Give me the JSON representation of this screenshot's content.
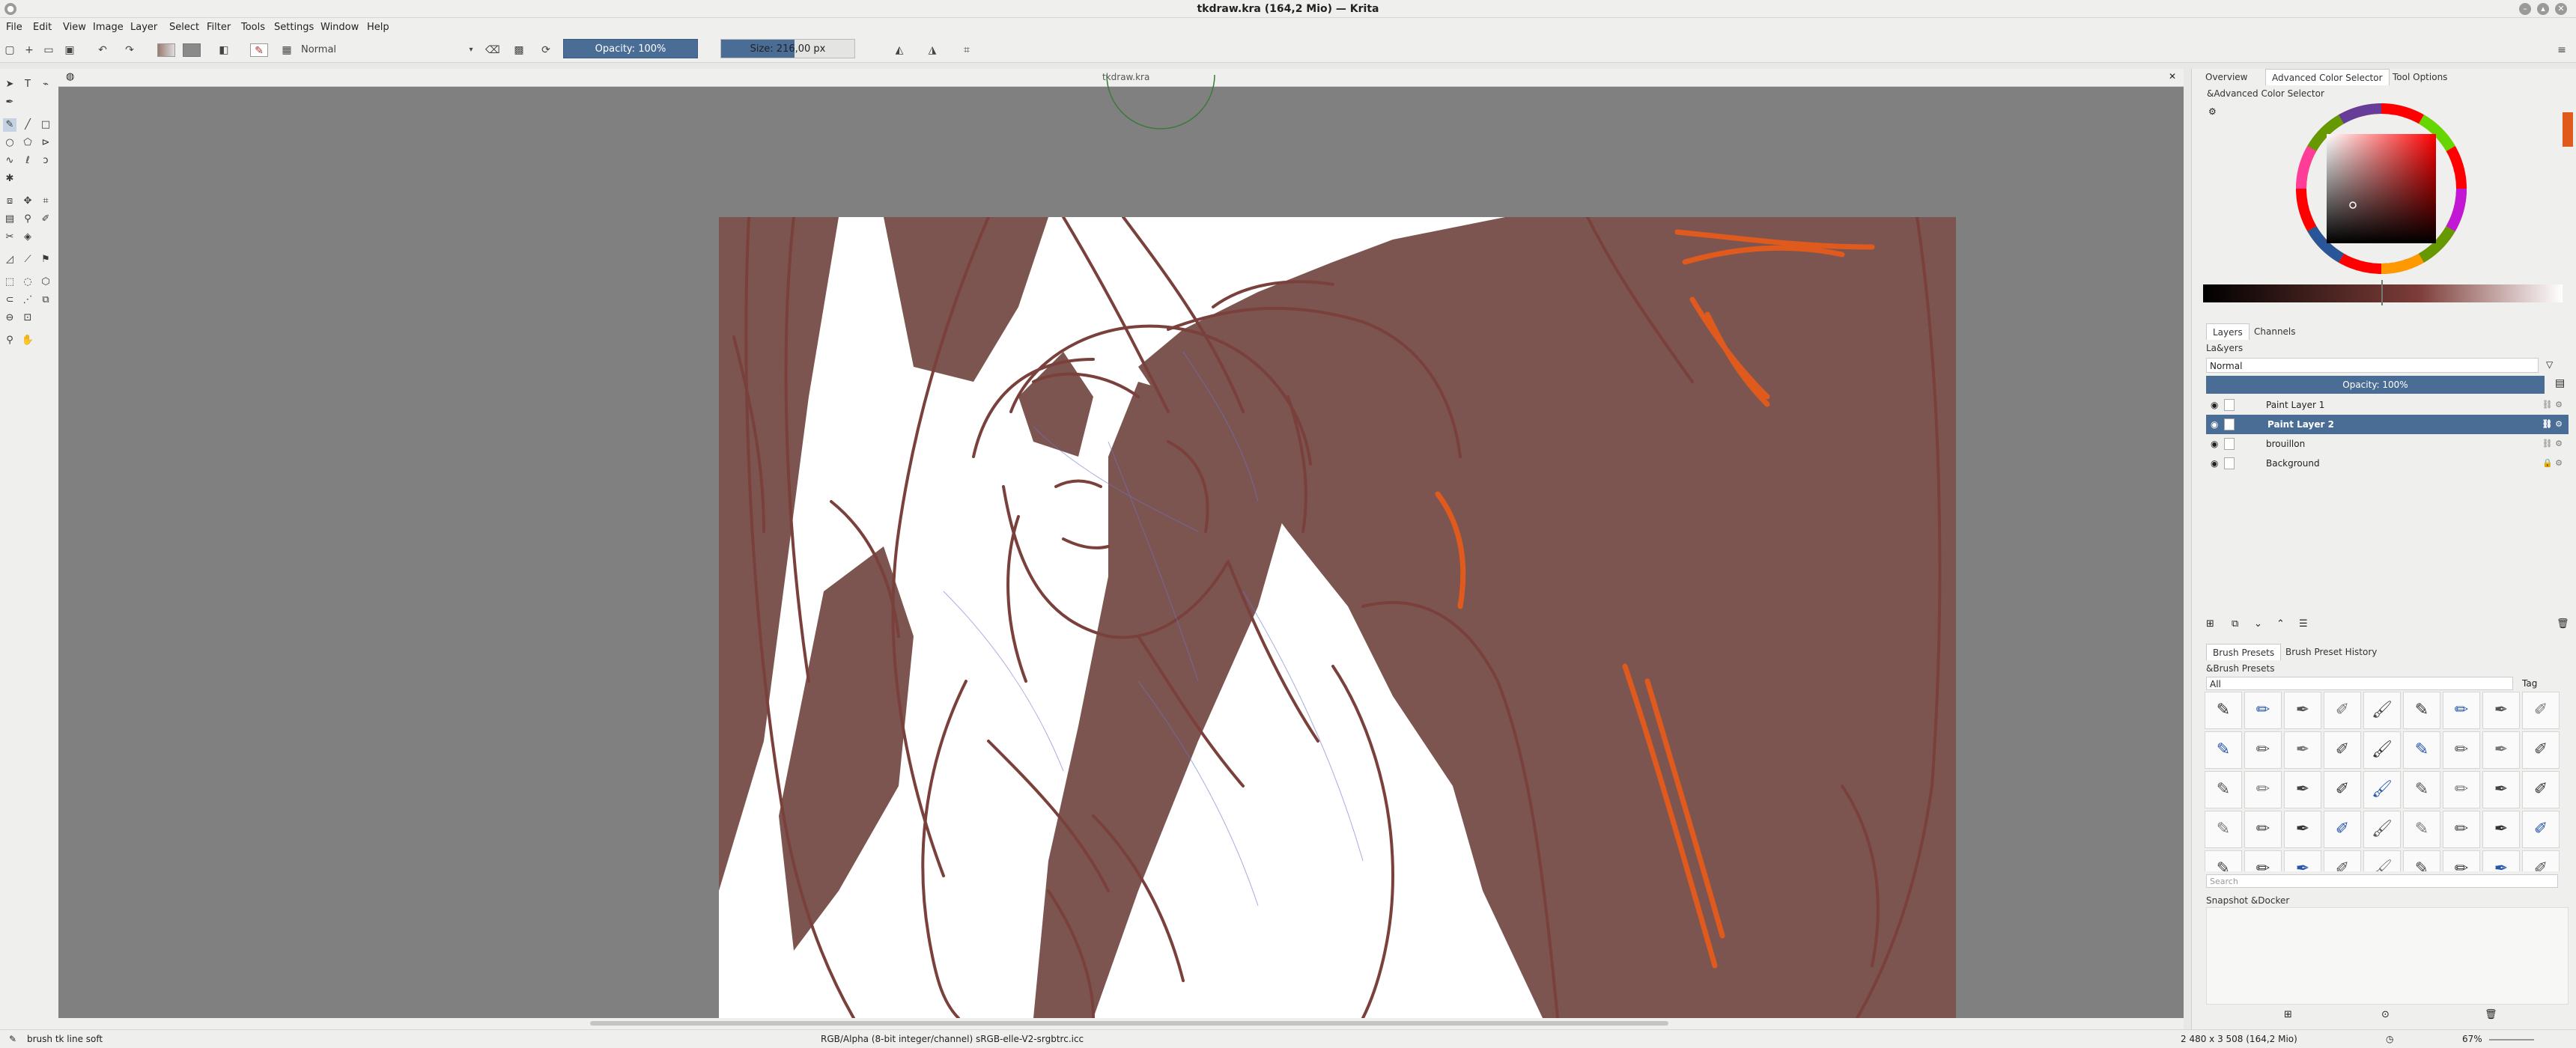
{
  "window": {
    "title": "tkdraw.kra (164,2 Mio)  — Krita"
  },
  "menu": [
    "File",
    "Edit",
    "View",
    "Image",
    "Layer",
    "Select",
    "Filter",
    "Tools",
    "Settings",
    "Window",
    "Help"
  ],
  "tool_options": {
    "blend_mode": "Normal",
    "opacity": "Opacity: 100%",
    "opacity_fill": 1.0,
    "size": "Size: 216,00 px",
    "size_fill": 0.55
  },
  "canvas": {
    "document_tab": "tkdraw.kra"
  },
  "dockers": {
    "top_tabs": [
      "Overview",
      "Advanced Color Selector",
      "Tool Options"
    ],
    "color_selector_title": "&Advanced Color Selector",
    "layers_tabs": [
      "Layers",
      "Channels"
    ],
    "layers_title": "La&yers",
    "layer_blend_mode": "Normal",
    "layer_opacity": "Opacity:  100%",
    "layers": [
      {
        "name": "Paint Layer 1",
        "selected": false,
        "locked": false
      },
      {
        "name": "Paint Layer 2",
        "selected": true,
        "locked": false
      },
      {
        "name": "brouillon",
        "selected": false,
        "locked": false
      },
      {
        "name": "Background",
        "selected": false,
        "locked": true
      }
    ],
    "presets_tabs": [
      "Brush Presets",
      "Brush Preset History"
    ],
    "presets_title": "&Brush Presets",
    "presets_filter": "All",
    "presets_tag": "Tag",
    "presets_search_placeholder": "Search",
    "snapshot_title": "Snapshot &Docker"
  },
  "status": {
    "brush": "brush tk line soft",
    "color_info": "RGB/Alpha (8-bit integer/channel)  sRGB-elle-V2-srgbtrc.icc",
    "dimensions": "2 480 x 3 508 (164,2 Mio)",
    "zoom": "67%"
  },
  "colors": {
    "accent": "#4a6d96",
    "sketch_brown": "#7a403b",
    "shadow_fill": "#7d5550",
    "orange": "#e05a1e",
    "canvas_bg": "#808080"
  }
}
